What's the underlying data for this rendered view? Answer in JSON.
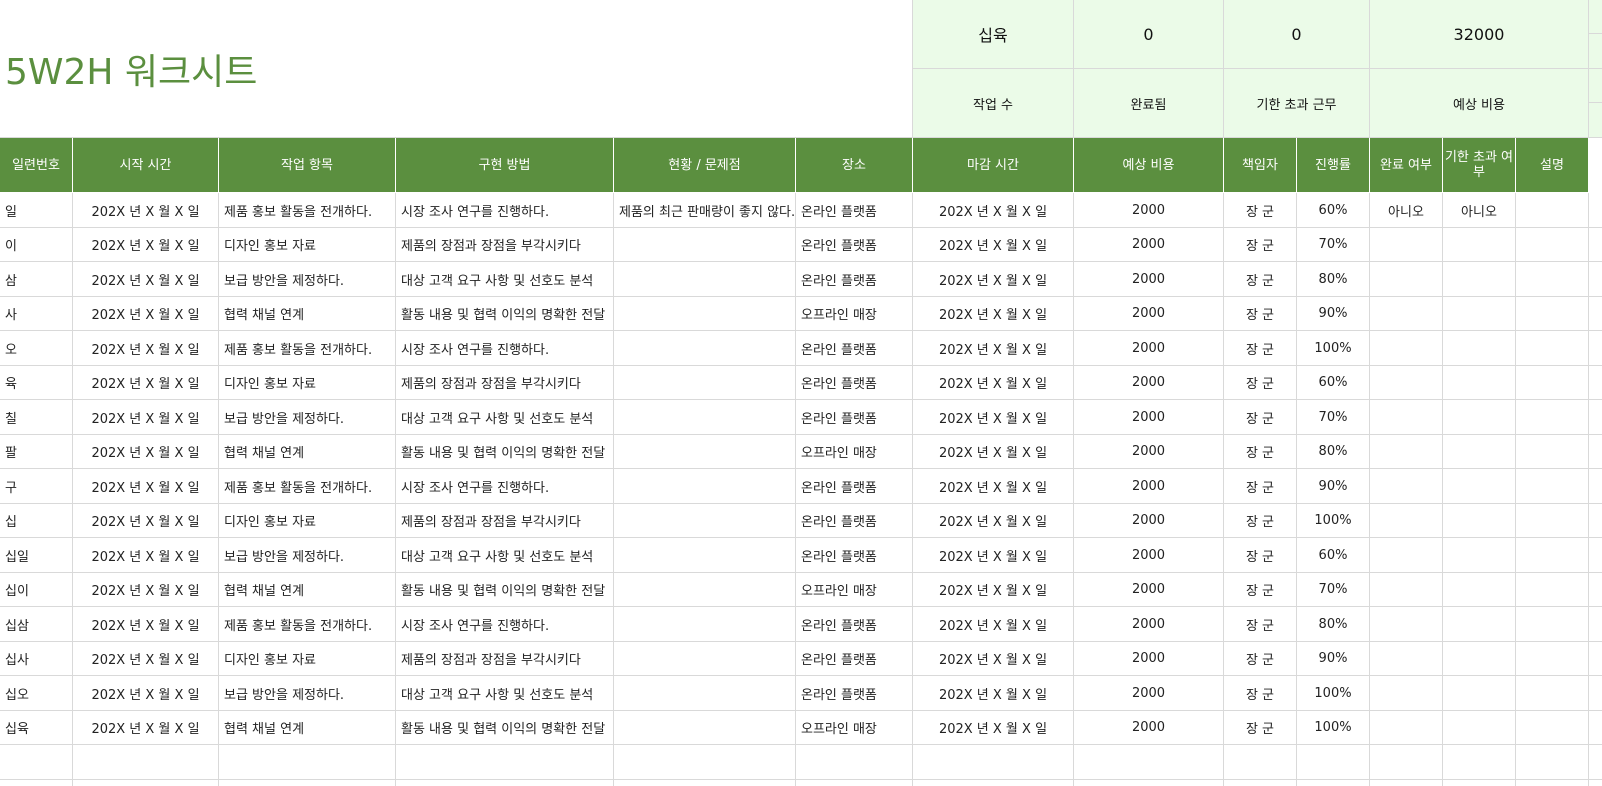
{
  "title": "5W2H 워크시트",
  "summary": {
    "values": [
      "십육",
      "0",
      "0",
      "32000"
    ],
    "labels": [
      "작업 수",
      "완료됨",
      "기한 초과 근무",
      "예상 비용"
    ]
  },
  "headers": [
    "일련번호",
    "시작 시간",
    "작업 항목",
    "구현 방법",
    "현황 / 문제점",
    "장소",
    "마감 시간",
    "예상 비용",
    "책임자",
    "진행률",
    "완료 여부",
    "기한 초과 여부",
    "설명"
  ],
  "rows": [
    [
      "일",
      "202X 년 X 월 X 일",
      "제품 홍보 활동을 전개하다.",
      "시장 조사 연구를 진행하다.",
      "제품의 최근 판매량이 좋지 않다.",
      "온라인 플랫폼",
      "202X 년 X 월 X 일",
      "2000",
      "장 군",
      "60%",
      "아니오",
      "아니오",
      ""
    ],
    [
      "이",
      "202X 년 X 월 X 일",
      "디자인 홍보 자료",
      "제품의 장점과 장점을 부각시키다",
      "",
      "온라인 플랫폼",
      "202X 년 X 월 X 일",
      "2000",
      "장 군",
      "70%",
      "",
      "",
      ""
    ],
    [
      "삼",
      "202X 년 X 월 X 일",
      "보급 방안을 제정하다.",
      "대상 고객 요구 사항 및 선호도 분석",
      "",
      "온라인 플랫폼",
      "202X 년 X 월 X 일",
      "2000",
      "장 군",
      "80%",
      "",
      "",
      ""
    ],
    [
      "사",
      "202X 년 X 월 X 일",
      "협력 채널 연계",
      "활동 내용 및 협력 이익의 명확한 전달",
      "",
      "오프라인 매장",
      "202X 년 X 월 X 일",
      "2000",
      "장 군",
      "90%",
      "",
      "",
      ""
    ],
    [
      "오",
      "202X 년 X 월 X 일",
      "제품 홍보 활동을 전개하다.",
      "시장 조사 연구를 진행하다.",
      "",
      "온라인 플랫폼",
      "202X 년 X 월 X 일",
      "2000",
      "장 군",
      "100%",
      "",
      "",
      ""
    ],
    [
      "육",
      "202X 년 X 월 X 일",
      "디자인 홍보 자료",
      "제품의 장점과 장점을 부각시키다",
      "",
      "온라인 플랫폼",
      "202X 년 X 월 X 일",
      "2000",
      "장 군",
      "60%",
      "",
      "",
      ""
    ],
    [
      "칠",
      "202X 년 X 월 X 일",
      "보급 방안을 제정하다.",
      "대상 고객 요구 사항 및 선호도 분석",
      "",
      "온라인 플랫폼",
      "202X 년 X 월 X 일",
      "2000",
      "장 군",
      "70%",
      "",
      "",
      ""
    ],
    [
      "팔",
      "202X 년 X 월 X 일",
      "협력 채널 연계",
      "활동 내용 및 협력 이익의 명확한 전달",
      "",
      "오프라인 매장",
      "202X 년 X 월 X 일",
      "2000",
      "장 군",
      "80%",
      "",
      "",
      ""
    ],
    [
      "구",
      "202X 년 X 월 X 일",
      "제품 홍보 활동을 전개하다.",
      "시장 조사 연구를 진행하다.",
      "",
      "온라인 플랫폼",
      "202X 년 X 월 X 일",
      "2000",
      "장 군",
      "90%",
      "",
      "",
      ""
    ],
    [
      "십",
      "202X 년 X 월 X 일",
      "디자인 홍보 자료",
      "제품의 장점과 장점을 부각시키다",
      "",
      "온라인 플랫폼",
      "202X 년 X 월 X 일",
      "2000",
      "장 군",
      "100%",
      "",
      "",
      ""
    ],
    [
      "십일",
      "202X 년 X 월 X 일",
      "보급 방안을 제정하다.",
      "대상 고객 요구 사항 및 선호도 분석",
      "",
      "온라인 플랫폼",
      "202X 년 X 월 X 일",
      "2000",
      "장 군",
      "60%",
      "",
      "",
      ""
    ],
    [
      "십이",
      "202X 년 X 월 X 일",
      "협력 채널 연계",
      "활동 내용 및 협력 이익의 명확한 전달",
      "",
      "오프라인 매장",
      "202X 년 X 월 X 일",
      "2000",
      "장 군",
      "70%",
      "",
      "",
      ""
    ],
    [
      "십삼",
      "202X 년 X 월 X 일",
      "제품 홍보 활동을 전개하다.",
      "시장 조사 연구를 진행하다.",
      "",
      "온라인 플랫폼",
      "202X 년 X 월 X 일",
      "2000",
      "장 군",
      "80%",
      "",
      "",
      ""
    ],
    [
      "십사",
      "202X 년 X 월 X 일",
      "디자인 홍보 자료",
      "제품의 장점과 장점을 부각시키다",
      "",
      "온라인 플랫폼",
      "202X 년 X 월 X 일",
      "2000",
      "장 군",
      "90%",
      "",
      "",
      ""
    ],
    [
      "십오",
      "202X 년 X 월 X 일",
      "보급 방안을 제정하다.",
      "대상 고객 요구 사항 및 선호도 분석",
      "",
      "온라인 플랫폼",
      "202X 년 X 월 X 일",
      "2000",
      "장 군",
      "100%",
      "",
      "",
      ""
    ],
    [
      "십육",
      "202X 년 X 월 X 일",
      "협력 채널 연계",
      "활동 내용 및 협력 이익의 명확한 전달",
      "",
      "오프라인 매장",
      "202X 년 X 월 X 일",
      "2000",
      "장 군",
      "100%",
      "",
      "",
      ""
    ]
  ],
  "colors": {
    "header_bg": "#5b8f3f",
    "summary_bg": "#ebfbe8",
    "title": "#5b8f3f",
    "grid": "#d9d9d9"
  }
}
